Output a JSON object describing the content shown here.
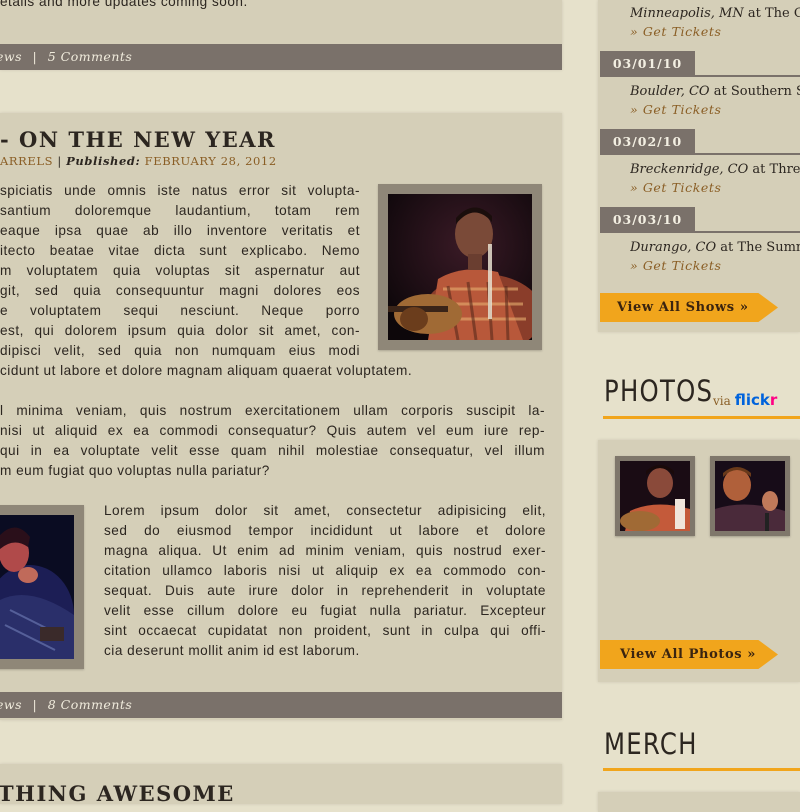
{
  "top_post": {
    "last_line": "etails and more updates coming soon.",
    "meta": {
      "category": "ews",
      "sep": "|",
      "comments": "5 Comments"
    }
  },
  "post": {
    "title": "- ON THE NEW YEAR",
    "byline": {
      "author": "ARRELS",
      "sep": "|",
      "published_label": "Published:",
      "date": "FEBRUARY 28, 2012"
    },
    "para1_lines": [
      "spiciatis unde omnis iste natus error sit volupta-",
      "santium doloremque laudantium, totam rem",
      "eaque ipsa quae ab illo inventore veritatis et",
      "itecto beatae vitae dicta sunt explicabo. Nemo",
      "m voluptatem quia voluptas sit aspernatur aut",
      "git, sed quia consequuntur magni dolores eos",
      "e voluptatem sequi nesciunt. Neque porro",
      "est, qui dolorem ipsum quia dolor sit amet, con-",
      "dipisci velit, sed quia non numquam eius modi",
      "cidunt ut labore et dolore magnam aliquam quaerat voluptatem."
    ],
    "para2_lines": [
      "l minima veniam, quis nostrum exercitationem ullam corporis suscipit la-",
      "nisi ut aliquid ex ea commodi consequatur? Quis autem vel eum iure rep-",
      "qui in ea voluptate velit esse quam nihil molestiae consequatur, vel illum",
      "m eum fugiat quo voluptas nulla pariatur?"
    ],
    "para3_lines": [
      "Lorem ipsum dolor sit amet, consectetur adipisicing elit,",
      "sed do eiusmod tempor incididunt ut labore et dolore",
      "magna aliqua. Ut enim ad minim veniam, quis nostrud exer-",
      "citation ullamco laboris nisi ut aliquip ex ea commodo con-",
      "sequat. Duis aute irure dolor in reprehenderit in voluptate",
      "velit esse cillum dolore eu fugiat nulla pariatur. Excepteur",
      "sint occaecat cupidatat non proident, sunt in culpa qui offi-",
      "cia deserunt mollit anim id est laborum."
    ],
    "meta": {
      "category": "ews",
      "sep": "|",
      "comments": "8 Comments"
    }
  },
  "next_post": {
    "title": "THING AWESOME"
  },
  "shows": {
    "top_partial": {
      "city": "Minneapolis, MN",
      "at": "at",
      "venue": "The C",
      "tickets": "» Get Tickets"
    },
    "items": [
      {
        "date": "03/01/10",
        "city": "Boulder, CO",
        "at": "at",
        "venue": "Southern S",
        "tickets": "» Get Tickets"
      },
      {
        "date": "03/02/10",
        "city": "Breckenridge, CO",
        "at": "at",
        "venue": "Three",
        "tickets": "» Get Tickets"
      },
      {
        "date": "03/03/10",
        "city": "Durango, CO",
        "at": "at",
        "venue": "The Summ",
        "tickets": "» Get Tickets"
      }
    ],
    "view_all": "View All Shows »"
  },
  "photos": {
    "heading": "PHOTOS",
    "via": "via",
    "flickr_a": "flick",
    "flickr_b": "r",
    "view_all": "View All Photos »"
  },
  "merch": {
    "heading": "MERCH"
  },
  "colors": {
    "page_bg": "#e6e1cb",
    "panel_bg": "#d5cfb8",
    "meta_bar": "#7a716a",
    "accent_orange": "#f1a51c",
    "link_brown": "#8a5e25",
    "flickr_blue": "#0063dc",
    "flickr_pink": "#ff0084"
  }
}
